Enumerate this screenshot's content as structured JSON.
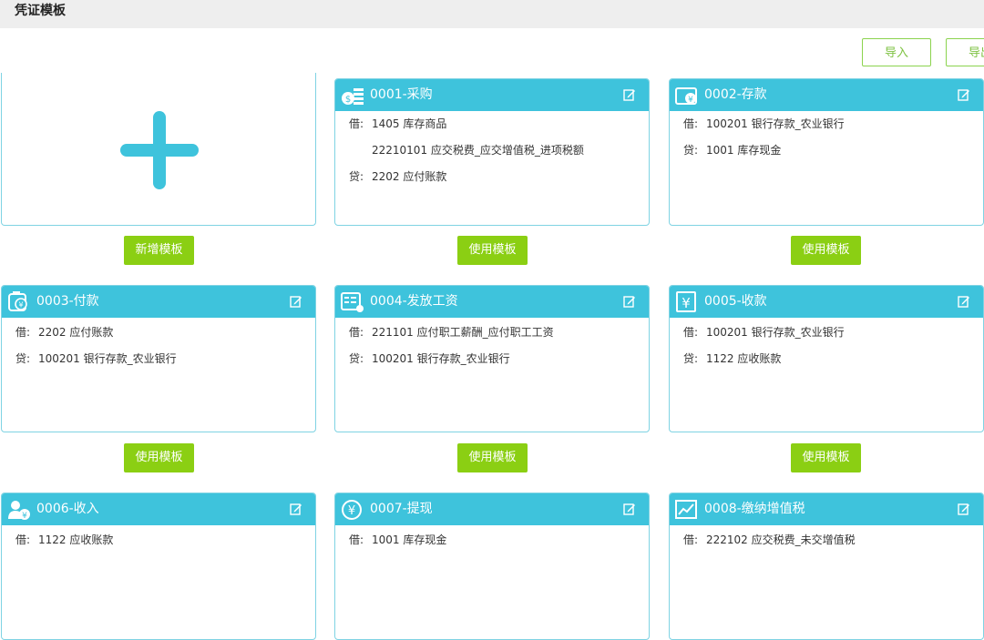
{
  "header": {
    "title": "凭证模板"
  },
  "toolbar": {
    "import_label": "导入",
    "export_label": "导出"
  },
  "add_card": {
    "button_label": "新增模板"
  },
  "use_label": "使用模板",
  "templates": [
    {
      "name": "0001-采购",
      "icon": "cash-stack-icon",
      "lines": [
        {
          "dir": "借:",
          "text": "1405 库存商品"
        },
        {
          "dir": "",
          "text": "22210101 应交税费_应交增值税_进项税额"
        },
        {
          "dir": "贷:",
          "text": "2202 应付账款"
        }
      ]
    },
    {
      "name": "0002-存款",
      "icon": "wallet-yuan-icon",
      "lines": [
        {
          "dir": "借:",
          "text": "100201 银行存款_农业银行"
        },
        {
          "dir": "贷:",
          "text": "1001 库存现金"
        }
      ]
    },
    {
      "name": "0003-付款",
      "icon": "payment-icon",
      "lines": [
        {
          "dir": "借:",
          "text": "2202 应付账款"
        },
        {
          "dir": "贷:",
          "text": "100201 银行存款_农业银行"
        }
      ]
    },
    {
      "name": "0004-发放工资",
      "icon": "calculator-icon",
      "lines": [
        {
          "dir": "借:",
          "text": "221101 应付职工薪酬_应付职工工资"
        },
        {
          "dir": "贷:",
          "text": "100201 银行存款_农业银行"
        }
      ]
    },
    {
      "name": "0005-收款",
      "icon": "yuan-box-icon",
      "lines": [
        {
          "dir": "借:",
          "text": "100201 银行存款_农业银行"
        },
        {
          "dir": "贷:",
          "text": "1122 应收账款"
        }
      ]
    },
    {
      "name": "0006-收入",
      "icon": "user-yuan-icon",
      "lines": [
        {
          "dir": "借:",
          "text": "1122 应收账款"
        }
      ]
    },
    {
      "name": "0007-提现",
      "icon": "yuan-circle-icon",
      "lines": [
        {
          "dir": "借:",
          "text": "1001 库存现金"
        }
      ]
    },
    {
      "name": "0008-缴纳增值税",
      "icon": "trend-chart-icon",
      "lines": [
        {
          "dir": "借:",
          "text": "222102 应交税费_未交增值税"
        }
      ]
    }
  ],
  "colors": {
    "accent": "#3ec3dc",
    "button_green": "#8bcf13",
    "outline_green": "#8bd34e"
  }
}
